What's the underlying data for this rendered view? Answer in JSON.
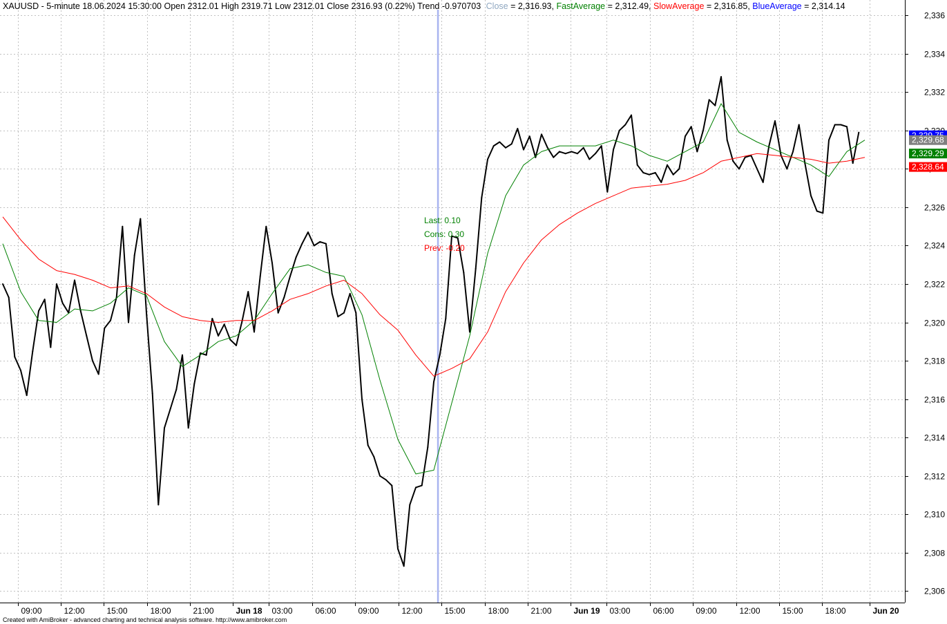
{
  "header": {
    "symbol_line": "XAUUSD - 5-minute 18.06.2024 15:30:00 Open 2312.01 High 2319.71 Low 2312.01 Close 2316.93 (0.22%) Trend -0.970703",
    "close_label": "Close",
    "close_value": " = 2,316.93, ",
    "fast_label": "FastAverage",
    "fast_value": " = 2,312.49, ",
    "slow_label": "SlowAverage",
    "slow_value": " = 2,316.85, ",
    "blue_label": "BlueAverage",
    "blue_value": " = 2,314.14"
  },
  "annotations": {
    "last": "Last: 0.10",
    "cons": "Cons: 0.30",
    "prev": "Prev: -0.20"
  },
  "price_tags": [
    {
      "text": "2,329.75",
      "value": 2329.75,
      "color": "#0000ff"
    },
    {
      "text": "2,329.68",
      "value": 2329.5,
      "color": "#808080"
    },
    {
      "text": "2,329.29",
      "value": 2328.8,
      "color": "#008000"
    },
    {
      "text": "2,328.64",
      "value": 2328.1,
      "color": "#ff0000"
    }
  ],
  "footer": "Created with AmiBroker - advanced charting and technical analysis software. http://www.amibroker.com",
  "colors": {
    "price": "#000000",
    "fast_average": "#008000",
    "slow_average": "#ff0000",
    "blue_average": "#0000ff",
    "close_label": "#8fa7c0",
    "cursor_line": "#a8b4f0",
    "grid": "#c0c0c0"
  },
  "chart_data": {
    "type": "line",
    "symbol": "XAUUSD",
    "interval": "5-minute",
    "ylim": [
      2305.4,
      2336.8
    ],
    "y_ticks": [
      "2,306",
      "2,308",
      "2,310",
      "2,312",
      "2,314",
      "2,316",
      "2,318",
      "2,320",
      "2,322",
      "2,324",
      "2,326",
      "2,328",
      "2,330",
      "2,332",
      "2,334",
      "2,336"
    ],
    "y_tick_values": [
      2306,
      2308,
      2310,
      2312,
      2314,
      2316,
      2318,
      2320,
      2322,
      2324,
      2326,
      2328,
      2330,
      2332,
      2334,
      2336
    ],
    "x_range": [
      0,
      150
    ],
    "x_ticks": [
      {
        "label": "09:00",
        "x": 2.5
      },
      {
        "label": "12:00",
        "x": 9.7
      },
      {
        "label": "15:00",
        "x": 16.9
      },
      {
        "label": "18:00",
        "x": 24.1
      },
      {
        "label": "21:00",
        "x": 31.3
      },
      {
        "label": "Jun 18",
        "x": 38.4,
        "bold": true
      },
      {
        "label": "03:00",
        "x": 44.4
      },
      {
        "label": "06:00",
        "x": 51.7
      },
      {
        "label": "09:00",
        "x": 58.9
      },
      {
        "label": "12:00",
        "x": 66.1
      },
      {
        "label": "15:00",
        "x": 73.3
      },
      {
        "label": "18:00",
        "x": 80.5
      },
      {
        "label": "21:00",
        "x": 87.7
      },
      {
        "label": "Jun 19",
        "x": 94.9,
        "bold": true
      },
      {
        "label": "03:00",
        "x": 100.9
      },
      {
        "label": "06:00",
        "x": 108.1
      },
      {
        "label": "09:00",
        "x": 115.3
      },
      {
        "label": "12:00",
        "x": 122.5
      },
      {
        "label": "15:00",
        "x": 129.7
      },
      {
        "label": "18:00",
        "x": 136.9
      },
      {
        "label": "Jun 20",
        "x": 144.8,
        "bold": true
      }
    ],
    "cursor_x": 72.7,
    "series": [
      {
        "name": "Close",
        "color": "#000000",
        "x": [
          0,
          1,
          2,
          3,
          4,
          5,
          6,
          7,
          8,
          9,
          10,
          11,
          12,
          13,
          14,
          15,
          16,
          17,
          18,
          19,
          20,
          21,
          22,
          23,
          24,
          25,
          26,
          27,
          28,
          29,
          30,
          31,
          32,
          33,
          34,
          35,
          36,
          37,
          38,
          39,
          40,
          41,
          42,
          43,
          44,
          45,
          46,
          47,
          48,
          49,
          50,
          51,
          52,
          53,
          54,
          55,
          56,
          57,
          58,
          59,
          60,
          61,
          62,
          63,
          64,
          65,
          66,
          67,
          68,
          69,
          70,
          71,
          72,
          73,
          74,
          75,
          76,
          77,
          78,
          79,
          80,
          81,
          82,
          83,
          84,
          85,
          86,
          87,
          88,
          89,
          90,
          91,
          92,
          93,
          94,
          95,
          96,
          97,
          98,
          99,
          100,
          101,
          102,
          103,
          104,
          105,
          106,
          107,
          108,
          109,
          110,
          111,
          112,
          113,
          114,
          115,
          116,
          117,
          118,
          119,
          120,
          121,
          122,
          123,
          124,
          125,
          126,
          127,
          128,
          129,
          130,
          131,
          132,
          133,
          134,
          135,
          136,
          137,
          138,
          139,
          140,
          141,
          142,
          143
        ],
        "y": [
          2322.0,
          2321.3,
          2318.2,
          2317.5,
          2316.2,
          2318.5,
          2320.6,
          2321.2,
          2318.7,
          2322.0,
          2321.0,
          2320.5,
          2322.2,
          2320.6,
          2319.3,
          2318.0,
          2317.3,
          2319.7,
          2320.1,
          2321.3,
          2325.0,
          2320.0,
          2323.5,
          2325.4,
          2320.5,
          2316.3,
          2310.5,
          2314.5,
          2315.5,
          2316.5,
          2318.3,
          2314.5,
          2316.8,
          2318.4,
          2318.3,
          2320.2,
          2319.3,
          2319.9,
          2319.1,
          2318.8,
          2320.1,
          2321.6,
          2319.5,
          2322.4,
          2325.0,
          2323.1,
          2320.5,
          2321.3,
          2322.4,
          2323.4,
          2324.1,
          2324.7,
          2324.0,
          2324.2,
          2324.1,
          2321.5,
          2320.3,
          2320.5,
          2321.5,
          2320.5,
          2316.0,
          2313.6,
          2313.0,
          2312.0,
          2311.8,
          2311.5,
          2308.2,
          2307.3,
          2310.5,
          2311.4,
          2311.5,
          2313.5,
          2316.9,
          2318.3,
          2320.2,
          2324.5,
          2324.4,
          2322.6,
          2319.5,
          2322.8,
          2326.5,
          2328.5,
          2329.2,
          2329.4,
          2329.1,
          2329.3,
          2330.1,
          2329.0,
          2329.7,
          2328.6,
          2329.8,
          2329.1,
          2328.6,
          2328.9,
          2328.8,
          2328.9,
          2328.8,
          2329.1,
          2328.5,
          2328.8,
          2329.2,
          2326.8,
          2329.0,
          2330.0,
          2330.3,
          2330.8,
          2328.2,
          2327.8,
          2327.7,
          2327.8,
          2327.3,
          2328.2,
          2327.7,
          2328.0,
          2329.7,
          2330.2,
          2328.9,
          2330.0,
          2331.6,
          2331.3,
          2332.8,
          2329.5,
          2328.4,
          2328.0,
          2328.6,
          2328.7,
          2328.0,
          2327.3,
          2329.2,
          2330.5,
          2328.7,
          2328.0,
          2328.9,
          2330.3,
          2328.3,
          2326.6,
          2325.8,
          2325.7,
          2329.5,
          2330.3,
          2330.3,
          2330.2,
          2328.3,
          2329.9
        ]
      },
      {
        "name": "FastAverage",
        "color": "#008000",
        "x": [
          0,
          3,
          6,
          9,
          12,
          15,
          18,
          21,
          24,
          27,
          30,
          33,
          36,
          39,
          42,
          45,
          48,
          51,
          54,
          57,
          60,
          63,
          66,
          69,
          72,
          75,
          78,
          81,
          84,
          87,
          90,
          93,
          96,
          99,
          102,
          105,
          108,
          111,
          114,
          117,
          120,
          123,
          126,
          129,
          132,
          135,
          138,
          141,
          144
        ],
        "y": [
          2324.1,
          2321.6,
          2320.1,
          2320.0,
          2320.7,
          2320.6,
          2321.0,
          2321.8,
          2321.4,
          2319.0,
          2317.7,
          2318.3,
          2319.0,
          2319.3,
          2320.1,
          2321.5,
          2322.8,
          2323.0,
          2322.6,
          2322.4,
          2320.4,
          2317.0,
          2313.9,
          2312.1,
          2312.3,
          2315.8,
          2319.3,
          2323.6,
          2326.6,
          2328.2,
          2328.9,
          2329.2,
          2329.2,
          2329.2,
          2329.5,
          2329.2,
          2328.7,
          2328.4,
          2328.9,
          2329.4,
          2331.4,
          2329.9,
          2329.4,
          2329.0,
          2328.6,
          2328.2,
          2327.6,
          2328.9,
          2329.5
        ]
      },
      {
        "name": "SlowAverage",
        "color": "#ff0000",
        "x": [
          0,
          3,
          6,
          9,
          12,
          15,
          18,
          21,
          24,
          27,
          30,
          33,
          36,
          39,
          42,
          45,
          48,
          51,
          54,
          57,
          60,
          63,
          66,
          69,
          72,
          75,
          78,
          81,
          84,
          87,
          90,
          93,
          96,
          99,
          102,
          105,
          108,
          111,
          114,
          117,
          120,
          123,
          126,
          129,
          132,
          135,
          138,
          141,
          144
        ],
        "y": [
          2325.5,
          2324.3,
          2323.3,
          2322.7,
          2322.5,
          2322.2,
          2321.8,
          2321.9,
          2321.5,
          2320.8,
          2320.3,
          2320.1,
          2320.0,
          2320.1,
          2320.1,
          2320.6,
          2321.2,
          2321.5,
          2321.9,
          2322.2,
          2321.5,
          2320.4,
          2319.6,
          2318.3,
          2317.2,
          2317.6,
          2318.1,
          2319.5,
          2321.6,
          2323.1,
          2324.3,
          2325.1,
          2325.7,
          2326.2,
          2326.6,
          2327.0,
          2327.1,
          2327.2,
          2327.4,
          2327.8,
          2328.4,
          2328.6,
          2328.8,
          2328.7,
          2328.6,
          2328.5,
          2328.3,
          2328.4,
          2328.6
        ]
      }
    ]
  }
}
